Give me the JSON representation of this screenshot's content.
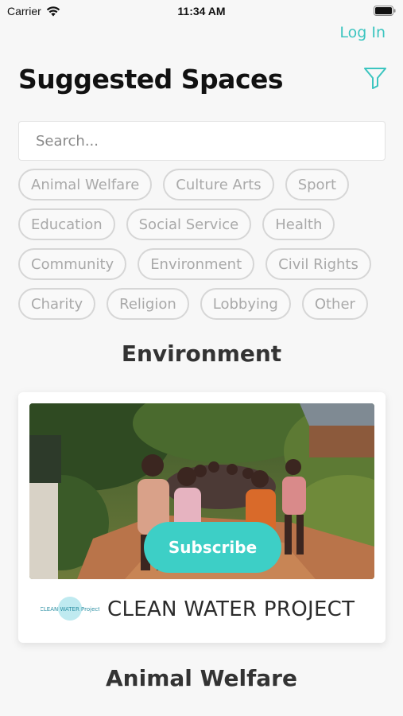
{
  "status_bar": {
    "carrier": "Carrier",
    "time": "11:34 AM",
    "icons": [
      "wifi-icon",
      "battery-icon"
    ]
  },
  "header": {
    "login_label": "Log In",
    "title": "Suggested Spaces",
    "filter_icon": "filter-icon"
  },
  "search": {
    "placeholder": "Search..."
  },
  "categories": [
    [
      "Animal Welfare",
      "Culture Arts",
      "Sport"
    ],
    [
      "Education",
      "Social Service",
      "Health"
    ],
    [
      "Community",
      "Environment",
      "Civil Rights"
    ],
    [
      "Charity",
      "Religion",
      "Lobbying",
      "Other"
    ]
  ],
  "sections": [
    {
      "title": "Environment",
      "card": {
        "subscribe_label": "Subscribe",
        "brand_name": "CLEAN WATER PROJECT",
        "logo_text": "CLEAN WATER Project"
      }
    },
    {
      "title": "Animal Welfare"
    }
  ],
  "colors": {
    "accent": "#3cc5c0",
    "subscribe": "#3dcfc6",
    "chip_border": "#d6d6d6",
    "chip_text": "#a9a9a9"
  }
}
